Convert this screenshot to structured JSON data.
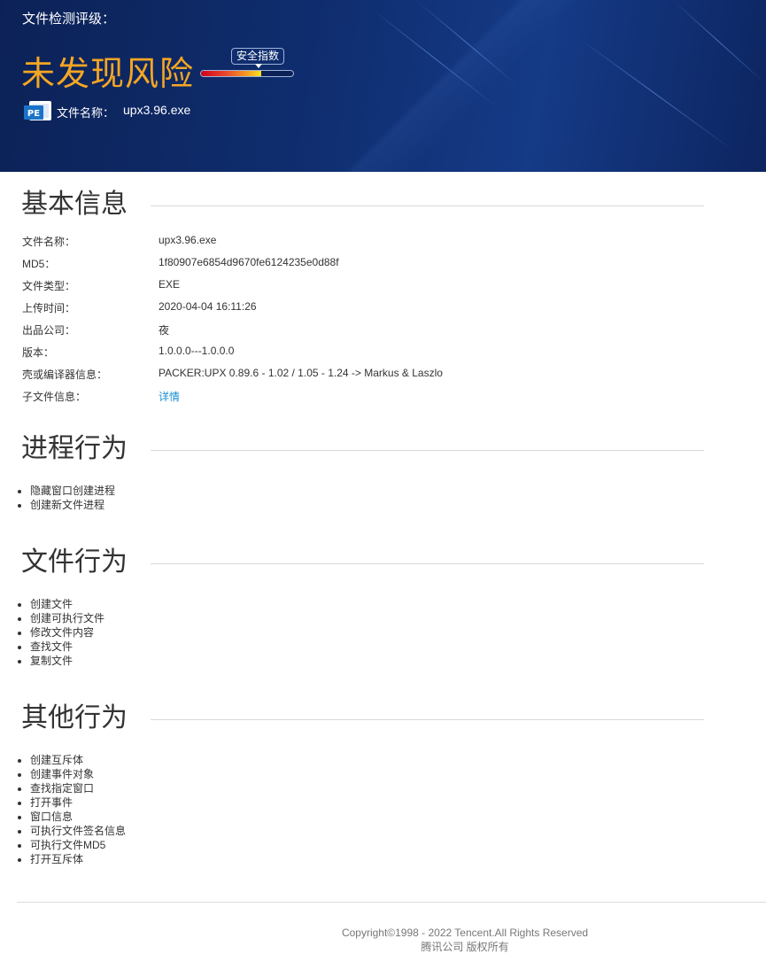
{
  "header": {
    "grade_label": "文件检测评级：",
    "verdict": "未发现风险",
    "verdict_color": "#f5a623",
    "meter_label": "安全指数",
    "safety_meter_level": 0.65,
    "file_icon": "pe-file-icon",
    "file_icon_text": "PE",
    "file_name_label": "文件名称：",
    "file_name_value": "upx3.96.exe"
  },
  "basic_info": {
    "title": "基本信息",
    "rows": [
      {
        "key": "文件名称：",
        "value": "upx3.96.exe"
      },
      {
        "key": "MD5：",
        "value": "1f80907e6854d9670fe6124235e0d88f"
      },
      {
        "key": "文件类型：",
        "value": "EXE"
      },
      {
        "key": "上传时间：",
        "value": "2020-04-04 16:11:26"
      },
      {
        "key": "出品公司：",
        "value": "夜"
      },
      {
        "key": "版本：",
        "value": "1.0.0.0---1.0.0.0"
      },
      {
        "key": "壳或编译器信息：",
        "value": "PACKER:UPX 0.89.6 - 1.02 / 1.05 - 1.24 -> Markus & Laszlo"
      },
      {
        "key": "子文件信息：",
        "value": "详情"
      }
    ]
  },
  "process_behavior": {
    "title": "进程行为",
    "items": [
      "隐藏窗口创建进程",
      "创建新文件进程"
    ]
  },
  "file_behavior": {
    "title": "文件行为",
    "items": [
      "创建文件",
      "创建可执行文件",
      "修改文件内容",
      "查找文件",
      "复制文件"
    ]
  },
  "other_behavior": {
    "title": "其他行为",
    "items": [
      "创建互斥体",
      "创建事件对象",
      "查找指定窗口",
      "打开事件",
      "窗口信息",
      "可执行文件签名信息",
      "可执行文件MD5",
      "打开互斥体"
    ]
  },
  "footer": {
    "copyright": "Copyright©1998 - 2022 Tencent.All Rights Reserved",
    "rights": "腾讯公司 版权所有"
  },
  "colors": {
    "banner": "#0f2d6e",
    "link": "#1a8fd0"
  }
}
